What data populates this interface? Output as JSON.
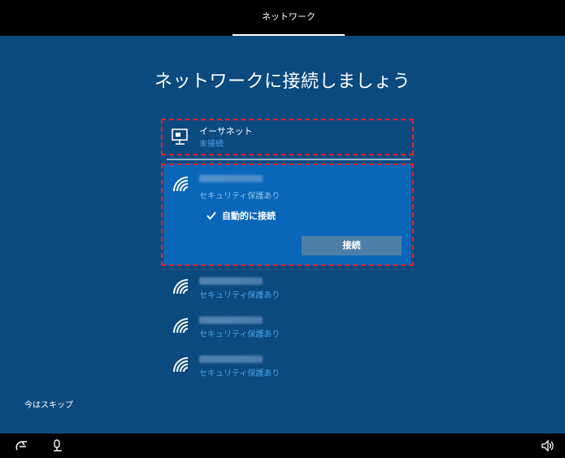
{
  "header": {
    "tab_label": "ネットワーク"
  },
  "main": {
    "title": "ネットワークに接続しましょう",
    "ethernet": {
      "name": "イーサネット",
      "status": "未接続",
      "icon": "ethernet-icon"
    },
    "selected_network": {
      "security": "セキュリティ保護あり",
      "auto_connect_label": "自動的に接続",
      "auto_connect_checked": true,
      "connect_button": "接続",
      "icon": "wifi-icon"
    },
    "networks": [
      {
        "security": "セキュリティ保護あり"
      },
      {
        "security": "セキュリティ保護あり"
      },
      {
        "security": "セキュリティ保護あり"
      }
    ]
  },
  "footer": {
    "skip_label": "今はスキップ",
    "icons": [
      "ease-of-access-icon",
      "microphone-icon",
      "speaker-icon"
    ]
  },
  "colors": {
    "background": "#0b4a7f",
    "selected": "#0a66b8",
    "accent_text": "#4aa3e8",
    "highlight_border": "#e8202a"
  }
}
